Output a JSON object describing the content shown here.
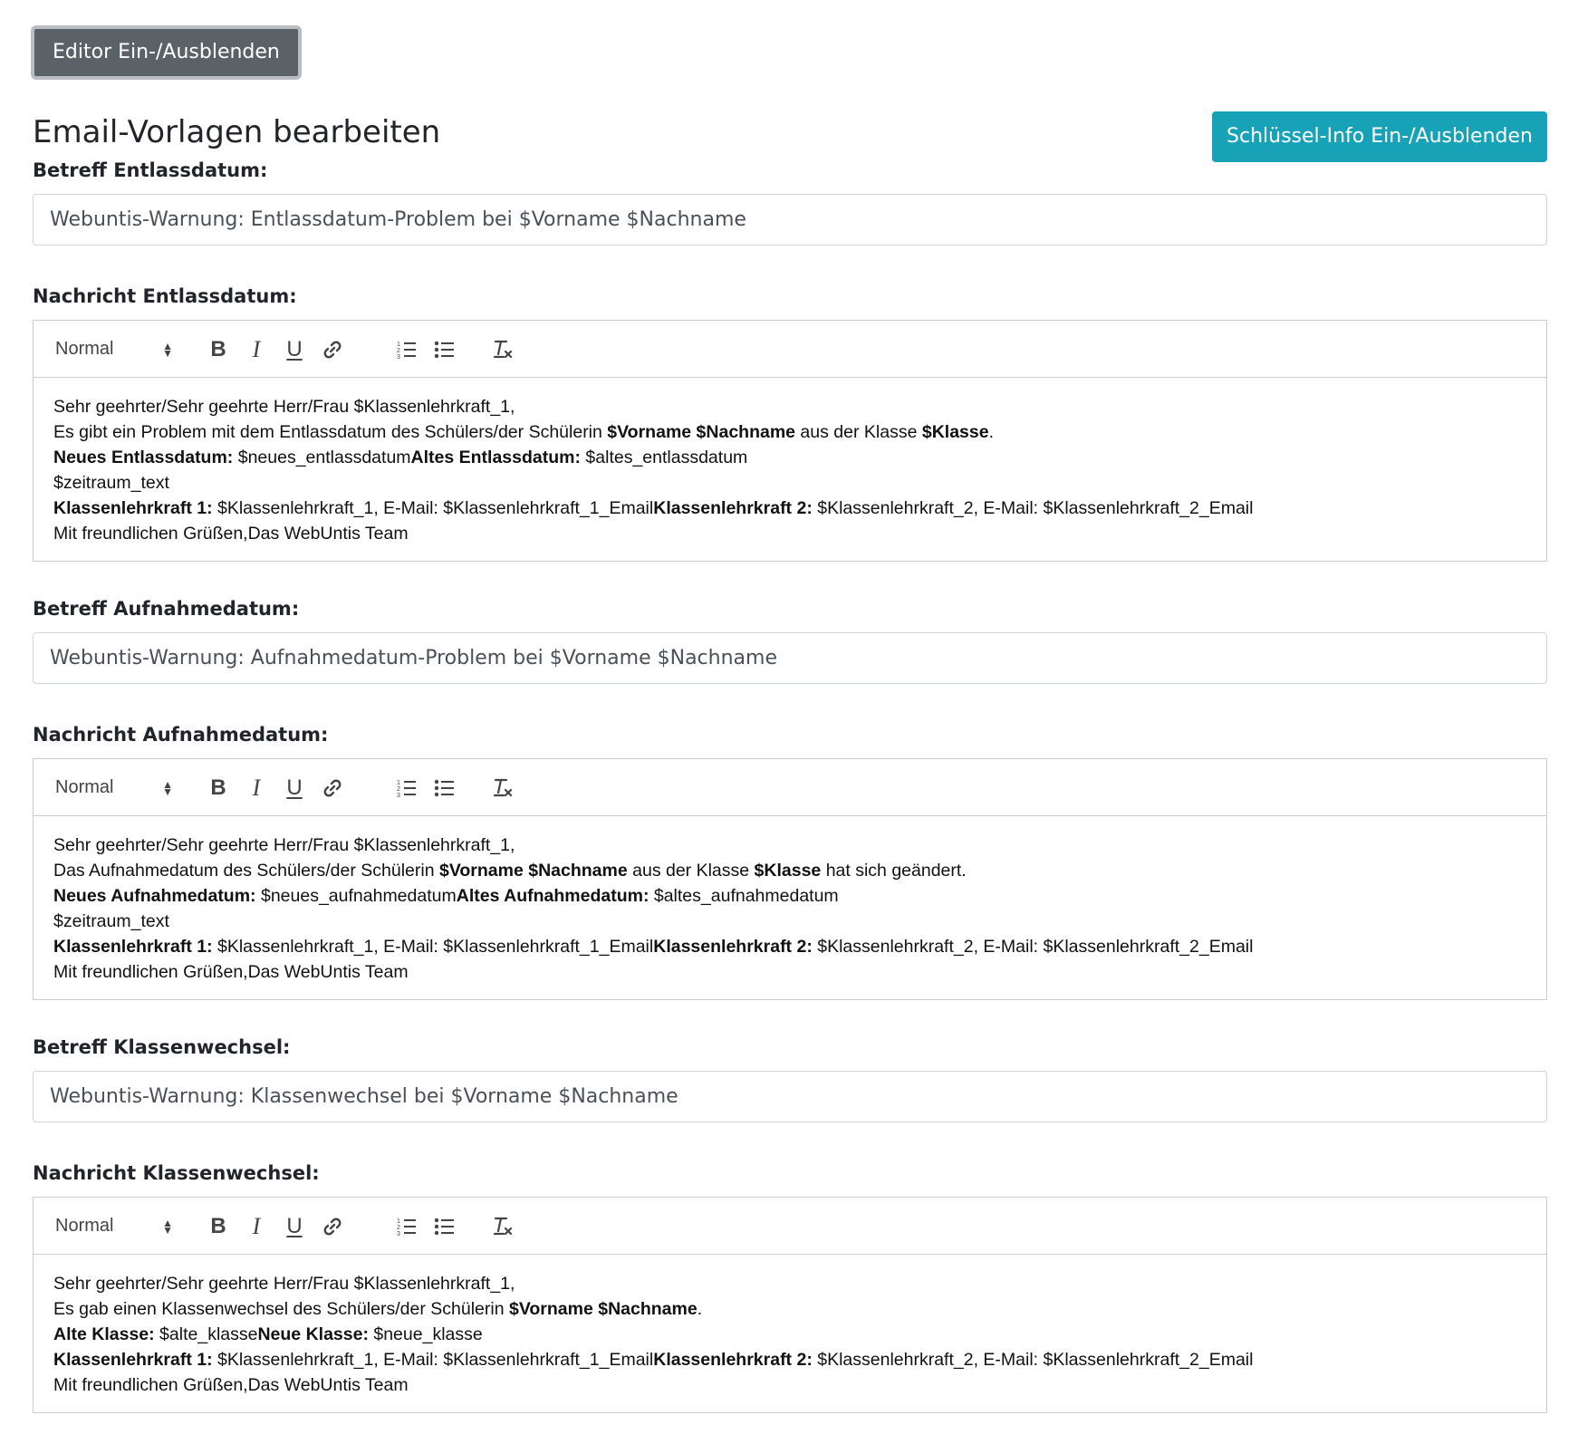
{
  "toggle_editor_label": "Editor Ein-/Ausblenden",
  "page_title": "Email-Vorlagen bearbeiten",
  "key_info_label": "Schlüssel-Info Ein-/Ausblenden",
  "toolbar": {
    "format_picker": "Normal"
  },
  "accent_colors": {
    "secondary": "#5a6268",
    "info": "#17a2b8"
  },
  "icons": [
    "bold-icon",
    "italic-icon",
    "underline-icon",
    "link-icon",
    "ordered-list-icon",
    "bullet-list-icon",
    "clear-format-icon"
  ],
  "sections": [
    {
      "subject_label": "Betreff Entlassdatum:",
      "subject_value": "Webuntis-Warnung: Entlassdatum-Problem bei $Vorname $Nachname",
      "message_label": "Nachricht Entlassdatum:",
      "lines": [
        [
          {
            "t": "Sehr geehrter/Sehr geehrte Herr/Frau $Klassenlehrkraft_1,"
          }
        ],
        [
          {
            "t": "Es gibt ein Problem mit dem Entlassdatum des Schülers/der Schülerin "
          },
          {
            "t": "$Vorname $Nachname",
            "b": true
          },
          {
            "t": " aus der Klasse "
          },
          {
            "t": "$Klasse",
            "b": true
          },
          {
            "t": "."
          }
        ],
        [
          {
            "t": "Neues Entlassdatum:",
            "b": true
          },
          {
            "t": " $neues_entlassdatum"
          },
          {
            "t": "Altes Entlassdatum:",
            "b": true
          },
          {
            "t": " $altes_entlassdatum"
          }
        ],
        [
          {
            "t": "$zeitraum_text"
          }
        ],
        [
          {
            "t": "Klassenlehrkraft 1:",
            "b": true
          },
          {
            "t": " $Klassenlehrkraft_1, E-Mail: $Klassenlehrkraft_1_Email"
          },
          {
            "t": "Klassenlehrkraft 2:",
            "b": true
          },
          {
            "t": " $Klassenlehrkraft_2, E-Mail: $Klassenlehrkraft_2_Email"
          }
        ],
        [
          {
            "t": "Mit freundlichen Grüßen,Das WebUntis Team"
          }
        ]
      ]
    },
    {
      "subject_label": "Betreff Aufnahmedatum:",
      "subject_value": "Webuntis-Warnung: Aufnahmedatum-Problem bei $Vorname $Nachname",
      "message_label": "Nachricht Aufnahmedatum:",
      "lines": [
        [
          {
            "t": "Sehr geehrter/Sehr geehrte Herr/Frau $Klassenlehrkraft_1,"
          }
        ],
        [
          {
            "t": "Das Aufnahmedatum des Schülers/der Schülerin "
          },
          {
            "t": "$Vorname $Nachname",
            "b": true
          },
          {
            "t": " aus der Klasse "
          },
          {
            "t": "$Klasse",
            "b": true
          },
          {
            "t": " hat sich geändert."
          }
        ],
        [
          {
            "t": "Neues Aufnahmedatum:",
            "b": true
          },
          {
            "t": " $neues_aufnahmedatum"
          },
          {
            "t": "Altes Aufnahmedatum:",
            "b": true
          },
          {
            "t": " $altes_aufnahmedatum"
          }
        ],
        [
          {
            "t": "$zeitraum_text"
          }
        ],
        [
          {
            "t": "Klassenlehrkraft 1:",
            "b": true
          },
          {
            "t": " $Klassenlehrkraft_1, E-Mail: $Klassenlehrkraft_1_Email"
          },
          {
            "t": "Klassenlehrkraft 2:",
            "b": true
          },
          {
            "t": " $Klassenlehrkraft_2, E-Mail: $Klassenlehrkraft_2_Email"
          }
        ],
        [
          {
            "t": "Mit freundlichen Grüßen,Das WebUntis Team"
          }
        ]
      ]
    },
    {
      "subject_label": "Betreff Klassenwechsel:",
      "subject_value": "Webuntis-Warnung: Klassenwechsel bei $Vorname $Nachname",
      "message_label": "Nachricht Klassenwechsel:",
      "lines": [
        [
          {
            "t": "Sehr geehrter/Sehr geehrte Herr/Frau $Klassenlehrkraft_1,"
          }
        ],
        [
          {
            "t": "Es gab einen Klassenwechsel des Schülers/der Schülerin "
          },
          {
            "t": "$Vorname $Nachname",
            "b": true
          },
          {
            "t": "."
          }
        ],
        [
          {
            "t": "Alte Klasse:",
            "b": true
          },
          {
            "t": " $alte_klasse"
          },
          {
            "t": "Neue Klasse:",
            "b": true
          },
          {
            "t": " $neue_klasse"
          }
        ],
        [
          {
            "t": "Klassenlehrkraft 1:",
            "b": true
          },
          {
            "t": " $Klassenlehrkraft_1, E-Mail: $Klassenlehrkraft_1_Email"
          },
          {
            "t": "Klassenlehrkraft 2:",
            "b": true
          },
          {
            "t": " $Klassenlehrkraft_2, E-Mail: $Klassenlehrkraft_2_Email"
          }
        ],
        [
          {
            "t": "Mit freundlichen Grüßen,Das WebUntis Team"
          }
        ]
      ]
    }
  ]
}
